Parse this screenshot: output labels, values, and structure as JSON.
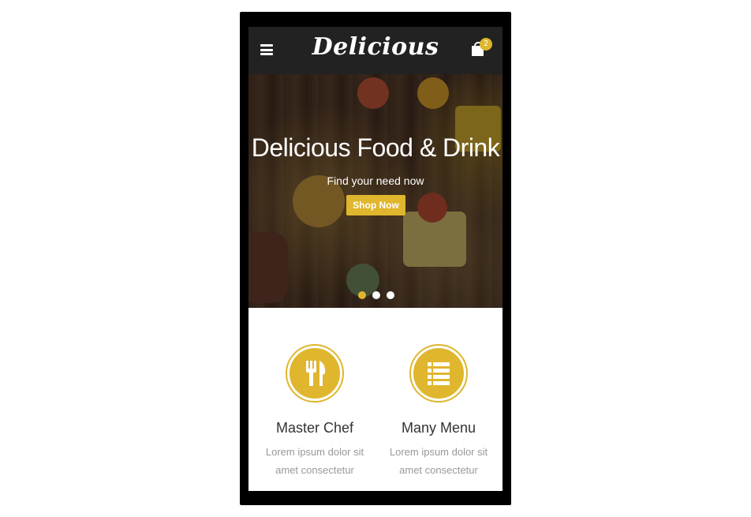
{
  "header": {
    "logo": "Delicious",
    "cart_count": "2"
  },
  "hero": {
    "title": "Delicious Food & Drink",
    "subtitle": "Find your need now",
    "button_label": "Shop Now"
  },
  "slider": {
    "active_index": 0,
    "dot_count": 3
  },
  "features": [
    {
      "title": "Master Chef",
      "text": "Lorem ipsum dolor sit amet consectetur",
      "icon": "fork-knife-icon"
    },
    {
      "title": "Many Menu",
      "text": "Lorem ipsum dolor sit amet consectetur",
      "icon": "menu-list-icon"
    }
  ],
  "colors": {
    "accent": "#dfb62d",
    "header_bg": "#222222",
    "frame": "#000000"
  }
}
